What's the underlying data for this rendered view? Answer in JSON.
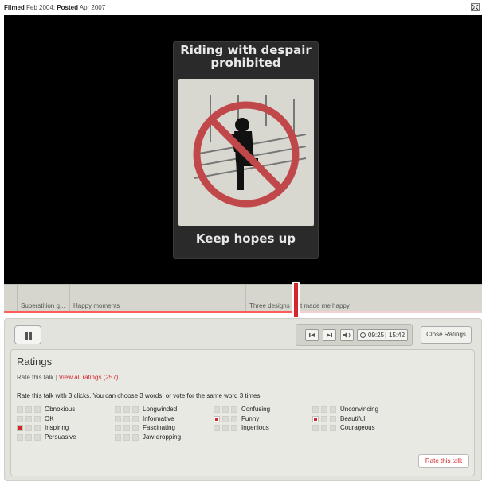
{
  "meta": {
    "filmed_label": "Filmed",
    "filmed_date": "Feb 2004",
    "posted_label": "Posted",
    "posted_date": "Apr 2007"
  },
  "video": {
    "sign_top": "Riding with despair prohibited",
    "sign_bottom": "Keep hopes up"
  },
  "chapters": [
    {
      "label": "Superstition g..."
    },
    {
      "label": "Happy moments"
    },
    {
      "label": "Three designs that made me happy"
    }
  ],
  "playback": {
    "progress_fraction": 0.61,
    "current_time": "09:25",
    "separator": "|",
    "total_time": "15:42"
  },
  "controls": {
    "close_ratings_label": "Close Ratings"
  },
  "ratings": {
    "title": "Ratings",
    "rate_link": "Rate this talk",
    "separator": "|",
    "view_all": "View all ratings (257)",
    "instructions": "Rate this talk with 3 clicks. You can choose 3 words, or vote for the same word 3 times.",
    "rate_button": "Rate this talk",
    "columns": [
      [
        {
          "label": "Obnoxious",
          "votes": 0
        },
        {
          "label": "OK",
          "votes": 0
        },
        {
          "label": "Inspiring",
          "votes": 1
        },
        {
          "label": "Persuasive",
          "votes": 0
        }
      ],
      [
        {
          "label": "Longwinded",
          "votes": 0
        },
        {
          "label": "Informative",
          "votes": 0
        },
        {
          "label": "Fascinating",
          "votes": 0
        },
        {
          "label": "Jaw-dropping",
          "votes": 0
        }
      ],
      [
        {
          "label": "Confusing",
          "votes": 0
        },
        {
          "label": "Funny",
          "votes": 1
        },
        {
          "label": "Ingenious",
          "votes": 0
        }
      ],
      [
        {
          "label": "Unconvincing",
          "votes": 0
        },
        {
          "label": "Beautiful",
          "votes": 1
        },
        {
          "label": "Courageous",
          "votes": 0
        }
      ]
    ]
  }
}
